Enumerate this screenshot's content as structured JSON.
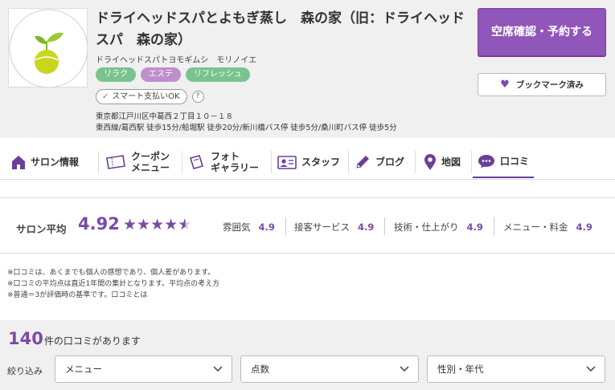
{
  "salon": {
    "title": "ドライヘッドスパとよもぎ蒸し　森の家（旧：ドライヘッドスパ　森の家）",
    "kana": "ドライヘッドスパトヨモギムシ　モリノイエ",
    "tags": [
      "リラク",
      "エステ",
      "リフレッシュ"
    ],
    "smart_pay": "スマート支払いOK",
    "help_glyph": "?",
    "address": "東京都江戸川区中葛西２丁目１０－１８",
    "access": "東西線/葛西駅 徒歩15分/船堀駅 徒歩20分/新川橋バス停 徒歩5分/桑川町バス停 徒歩5分"
  },
  "buttons": {
    "reserve": "空席確認・予約する",
    "bookmark": "ブックマーク済み"
  },
  "tabs": [
    {
      "label": "サロン情報",
      "icon": "home-icon"
    },
    {
      "label": "クーポン\nメニュー",
      "icon": "ticket-icon"
    },
    {
      "label": "フォト\nギャラリー",
      "icon": "photo-icon"
    },
    {
      "label": "スタッフ",
      "icon": "id-card-icon"
    },
    {
      "label": "ブログ",
      "icon": "pencil-icon"
    },
    {
      "label": "地図",
      "icon": "map-pin-icon"
    },
    {
      "label": "口コミ",
      "icon": "speech-bubble-icon"
    }
  ],
  "active_tab": "口コミ",
  "rating": {
    "label": "サロン平均",
    "score": "4.92",
    "stars_value": 4.92,
    "stars_max": 5,
    "sub": [
      {
        "label": "雰囲気",
        "value": "4.9"
      },
      {
        "label": "接客サービス",
        "value": "4.9"
      },
      {
        "label": "技術・仕上がり",
        "value": "4.9"
      },
      {
        "label": "メニュー・料金",
        "value": "4.9"
      }
    ]
  },
  "notes": [
    "※口コミは、あくまでも個人の感想であり、個人差があります。",
    "※口コミの平均点は直近1年間の集計となります。平均点の考え方",
    "※普通＝3が評価時の基準です。口コミとは"
  ],
  "reviews": {
    "count": "140",
    "count_suffix": "件の口コミがあります"
  },
  "filters": {
    "label": "絞り込み",
    "menu": "メニュー",
    "score": "点数",
    "gender_age": "性別・年代"
  },
  "colors": {
    "accent": "#7b4aa8",
    "reserve_bg": "#9156b9",
    "tag_green": "#7ac38f",
    "tag_purple": "#c08fcb"
  }
}
